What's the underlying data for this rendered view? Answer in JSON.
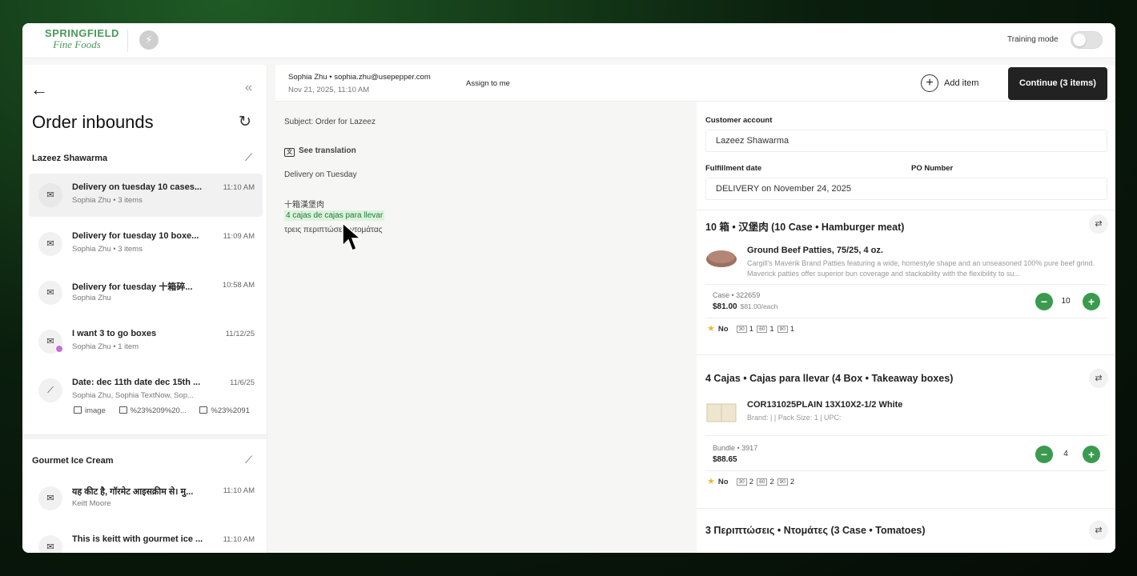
{
  "brand": {
    "line1": "SPRINGFIELD",
    "line2": "Fine Foods"
  },
  "topbar": {
    "training_label": "Training mode",
    "training_on": false
  },
  "sidebar": {
    "title": "Order inbounds",
    "groups": [
      {
        "name": "Lazeez Shawarma",
        "items": [
          {
            "subject": "Delivery on tuesday 10 cases...",
            "meta": "Sophia Zhu • 3 items",
            "time": "11:10 AM",
            "active": true
          },
          {
            "subject": "Delivery for tuesday 10 boxe...",
            "meta": "Sophia Zhu • 3 items",
            "time": "11:09 AM"
          },
          {
            "subject": "Delivery for tuesday 十箱碎...",
            "meta": "Sophia Zhu",
            "time": "10:58 AM"
          },
          {
            "subject": "I want 3 to go boxes",
            "meta": "Sophia Zhu • 1 item",
            "time": "11/12/25",
            "badge": true
          },
          {
            "subject": "Date: dec 11th date dec 15th ...",
            "meta": "Sophia Zhu, Sophia TextNow, Sop...",
            "time": "11/6/25",
            "attachments": [
              "image",
              "%23%209%20...",
              "%23%2091"
            ]
          }
        ]
      },
      {
        "name": "Gourmet Ice Cream",
        "items": [
          {
            "subject": "यह कीट है, गॉरमेट आइसक्रीम से। मु...",
            "meta": "Keitt Moore",
            "time": "11:10 AM"
          },
          {
            "subject": "This is keitt with gourmet ice ...",
            "meta": "",
            "time": "11:10 AM"
          }
        ]
      }
    ]
  },
  "message": {
    "sender": "Sophia Zhu • sophia.zhu@usepepper.com",
    "date": "Nov 21, 2025, 11:10 AM",
    "assign": "Assign to me",
    "add_item": "Add item",
    "continue": "Continue (3 items)",
    "subject": "Subject: Order for Lazeez",
    "see_translation": "See translation",
    "body": [
      "Delivery on Tuesday",
      "十箱漢堡肉",
      "4 cajas de cajas para llevar",
      "τρεις περιπτώσεις ντομάτας"
    ]
  },
  "form": {
    "customer_label": "Customer account",
    "customer_value": "Lazeez Shawarma",
    "fulfillment_label": "Fulfillment date",
    "fulfillment_value": "DELIVERY on November 24, 2025",
    "po_label": "PO Number",
    "po_value": "",
    "lines": [
      {
        "heading": "10 箱 • 汉堡肉 (10 Case • Hamburger meat)",
        "product": "Ground Beef Patties, 75/25, 4 oz.",
        "desc": "Cargill's Maverik Brand Patties featuring a wide, homestyle shape and an unseasoned 100% pure beef grind. Maverick patties offer superior bun coverage and stackability with the flexibility to su...",
        "sku": "Case • 322659",
        "price": "$81.00",
        "unit_price": "$81.00/each",
        "qty": "10",
        "history": {
          "flag": "No",
          "d30": "1",
          "d60": "1",
          "d90": "1"
        }
      },
      {
        "heading": "4 Cajas • Cajas para llevar (4 Box • Takeaway boxes)",
        "product": "COR131025PLAIN 13X10X2-1/2 White",
        "desc": "Brand: | | Pack Size: 1 | UPC:",
        "sku": "Bundle • 3917",
        "price": "$88.65",
        "unit_price": "",
        "qty": "4",
        "history": {
          "flag": "No",
          "d30": "2",
          "d60": "2",
          "d90": "2"
        }
      },
      {
        "heading": "3 Περιπτώσεις • Ντομάτες (3 Case • Tomatoes)"
      }
    ]
  },
  "history_boxes": [
    "30",
    "60",
    "90"
  ],
  "colors": {
    "accent_green": "#3a9a4e",
    "brand_green": "#4a9a5a",
    "primary_dark": "#222222"
  }
}
